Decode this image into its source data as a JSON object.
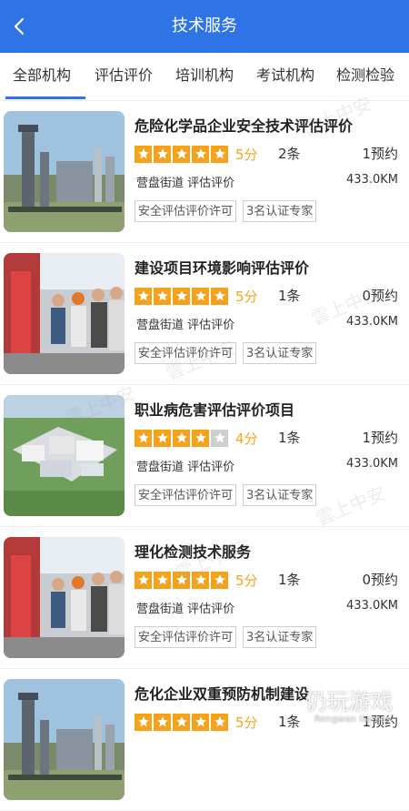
{
  "header": {
    "title": "技术服务"
  },
  "tabs": [
    {
      "label": "全部机构",
      "active": true
    },
    {
      "label": "评估评价",
      "active": false
    },
    {
      "label": "培训机构",
      "active": false
    },
    {
      "label": "考试机构",
      "active": false
    },
    {
      "label": "检测检验",
      "active": false
    }
  ],
  "colors": {
    "brand": "#2f74e6",
    "star": "#f5a21b",
    "star_off": "#cfcfcf"
  },
  "items": [
    {
      "name": "危险化学品企业安全技术评估评价",
      "stars": 5,
      "score": "5分",
      "count": "2条",
      "booked": "1预约",
      "location": "营盘街道 评估评价",
      "distance": "433.0KM",
      "tags": [
        "安全评估评价许可",
        "3名认证专家"
      ],
      "image": "industrial-plant"
    },
    {
      "name": "建设项目环境影响评估评价",
      "stars": 5,
      "score": "5分",
      "count": "1条",
      "booked": "0预约",
      "location": "营盘街道 评估评价",
      "distance": "433.0KM",
      "tags": [
        "安全评估评价许可",
        "3名认证专家"
      ],
      "image": "workers-inspection"
    },
    {
      "name": "职业病危害评估评价项目",
      "stars": 4,
      "score": "4分",
      "count": "1条",
      "booked": "1预约",
      "location": "营盘街道 评估评价",
      "distance": "433.0KM",
      "tags": [
        "安全评估评价许可",
        "3名认证专家"
      ],
      "image": "factory-aerial"
    },
    {
      "name": "理化检测技术服务",
      "stars": 5,
      "score": "5分",
      "count": "1条",
      "booked": "0预约",
      "location": "营盘街道 评估评价",
      "distance": "433.0KM",
      "tags": [
        "安全评估评价许可",
        "3名认证专家"
      ],
      "image": "workers-inspection"
    },
    {
      "name": "危化企业双重预防机制建设",
      "stars": 5,
      "score": "5分",
      "count": "1条",
      "booked": "1预约",
      "location": "",
      "distance": "",
      "tags": [],
      "image": "industrial-plant"
    }
  ],
  "watermarks": {
    "text": "雲上中安",
    "brand": "仍玩游戏",
    "brand_sub": "Rengwan Games"
  }
}
